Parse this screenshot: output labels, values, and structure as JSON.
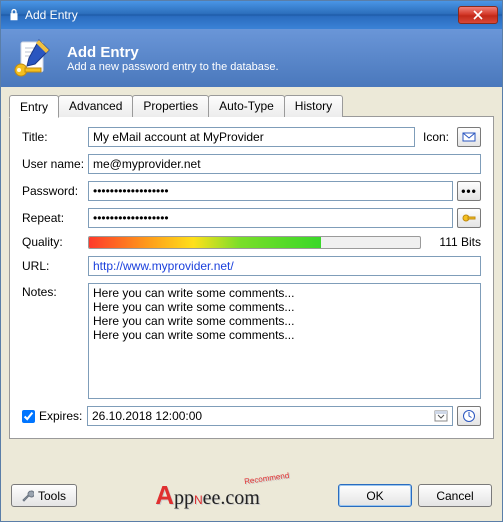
{
  "window": {
    "title": "Add Entry"
  },
  "header": {
    "title": "Add Entry",
    "subtitle": "Add a new password entry to the database."
  },
  "tabs": [
    "Entry",
    "Advanced",
    "Properties",
    "Auto-Type",
    "History"
  ],
  "form": {
    "title_label": "Title:",
    "title_value": "My eMail account at MyProvider",
    "icon_label": "Icon:",
    "username_label": "User name:",
    "username_value": "me@myprovider.net",
    "password_label": "Password:",
    "password_value": "••••••••••••••••••",
    "repeat_label": "Repeat:",
    "repeat_value": "••••••••••••••••••",
    "quality_label": "Quality:",
    "quality_text": "111 Bits",
    "url_label": "URL:",
    "url_value": "http://www.myprovider.net/",
    "notes_label": "Notes:",
    "notes_value": "Here you can write some comments...\nHere you can write some comments...\nHere you can write some comments...\nHere you can write some comments...",
    "expires_label": "Expires:",
    "expires_value": "26.10.2018 12:00:00"
  },
  "footer": {
    "tools": "Tools",
    "brand": "AppNee.com",
    "brand_tag": "Recommend",
    "ok": "OK",
    "cancel": "Cancel"
  }
}
